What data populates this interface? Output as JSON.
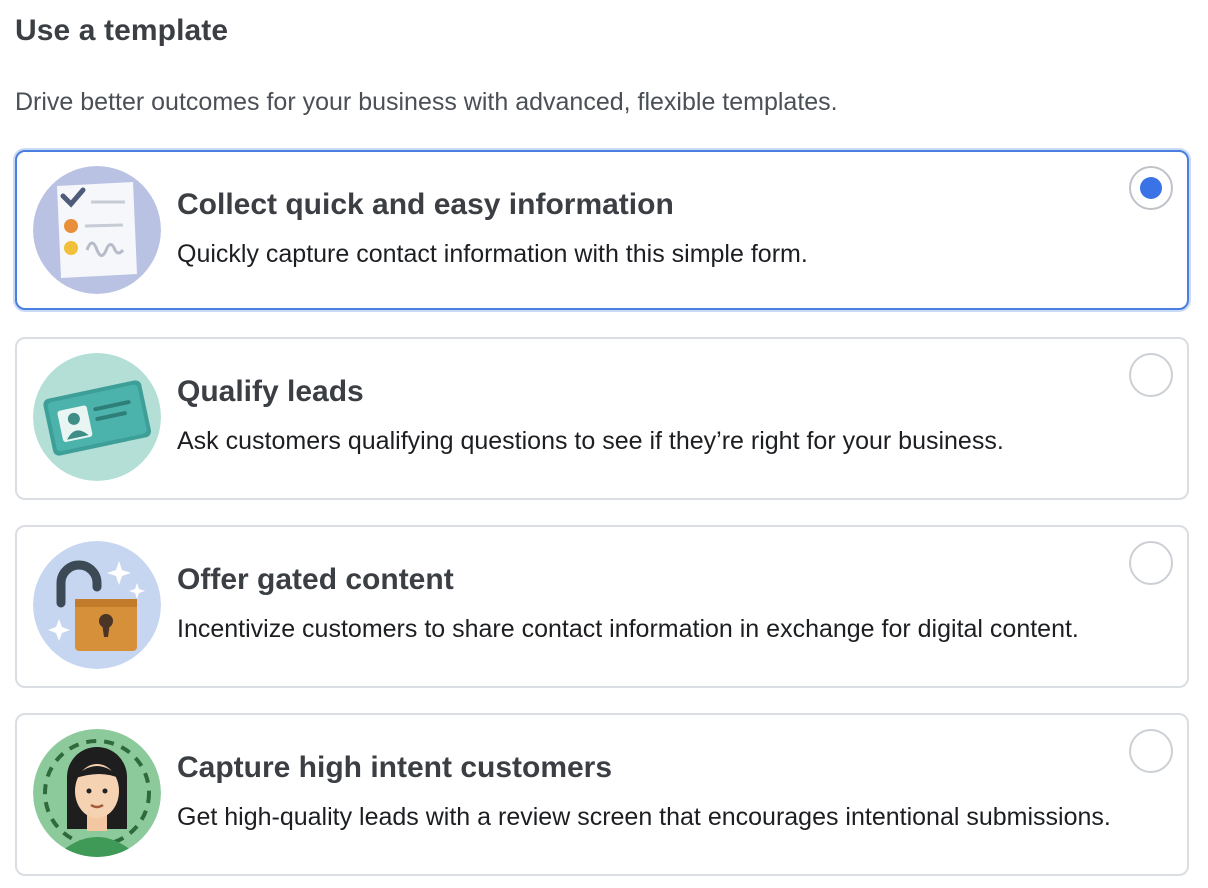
{
  "page": {
    "title": "Use a template",
    "subtitle": "Drive better outcomes for your business with advanced, flexible templates."
  },
  "options": [
    {
      "title": "Collect quick and easy information",
      "description": "Quickly capture contact information with this simple form.",
      "icon": "form-checklist-icon",
      "selected": true
    },
    {
      "title": "Qualify leads",
      "description": "Ask customers qualifying questions to see if they’re right for your business.",
      "icon": "id-card-icon",
      "selected": false
    },
    {
      "title": "Offer gated content",
      "description": "Incentivize customers to share contact information in exchange for digital content.",
      "icon": "unlocked-padlock-icon",
      "selected": false
    },
    {
      "title": "Capture high intent customers",
      "description": "Get high-quality leads with a review screen that encourages intentional submissions.",
      "icon": "person-avatar-icon",
      "selected": false
    }
  ],
  "colors": {
    "selected_border": "#4a7fe0",
    "radio_fill": "#3a73e6",
    "card_border": "#dadde1"
  }
}
